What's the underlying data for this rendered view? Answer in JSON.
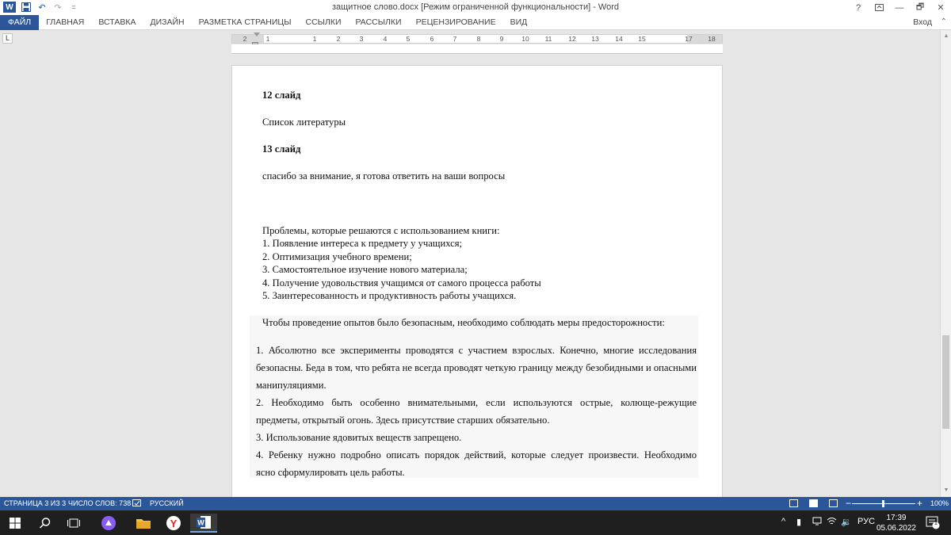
{
  "window": {
    "title": "защитное слово.docx [Режим ограниченной функциональности] - Word",
    "help": "?",
    "minimize": "—",
    "restore": "🗗",
    "close": "✕",
    "app_logo": "W"
  },
  "qat": {
    "save_icon": "save-icon",
    "undo_icon": "undo-icon",
    "redo_icon": "redo-icon",
    "customize": "="
  },
  "ribbon": {
    "tabs": [
      "ФАЙЛ",
      "ГЛАВНАЯ",
      "ВСТАВКА",
      "ДИЗАЙН",
      "РАЗМЕТКА СТРАНИЦЫ",
      "ССЫЛКИ",
      "РАССЫЛКИ",
      "РЕЦЕНЗИРОВАНИЕ",
      "ВИД"
    ],
    "signin": "Вход",
    "collapse": "⌃"
  },
  "ruler": {
    "tab_selector": "L",
    "numbers": [
      "2",
      "1",
      "1",
      "2",
      "3",
      "4",
      "5",
      "6",
      "7",
      "8",
      "9",
      "10",
      "11",
      "12",
      "13",
      "14",
      "15",
      "17",
      "18"
    ]
  },
  "document": {
    "h12": "12 слайд",
    "p1": "Список литературы",
    "h13": "13 слайд",
    "p2": "спасибо за внимание, я готова ответить на ваши вопросы",
    "problems_title": "Проблемы, которые решаются с использованием книги:",
    "problems": [
      "1.  Появление интереса к предмету у учащихся;",
      "2.  Оптимизация учебного времени;",
      "3.  Самостоятельное изучение нового материала;",
      "4.  Получение удовольствия учащимся от самого процесса работы",
      "5.  Заинтересованность и продуктивность работы учащихся."
    ],
    "safety_intro": "Чтобы проведение опытов было безопасным, необходимо соблюдать меры предосторожности:",
    "safety": [
      {
        "lines": [
          "1.    Абсолютно все эксперименты проводятся с участием взрослых. Конечно, многие исследования",
          "безопасны. Беда в том, что ребята не всегда проводят четкую границу между безобидными и опасными",
          "манипуляциями."
        ]
      },
      {
        "lines": [
          "2.    Необходимо быть особенно внимательными, если используются острые, колюще-режущие",
          "предметы, открытый огонь. Здесь присутствие старших обязательно."
        ]
      },
      {
        "lines": [
          "3.    Использование ядовитых веществ запрещено."
        ]
      },
      {
        "lines": [
          "4.    Ребенку нужно подробно описать порядок действий, которые следует произвести. Необходимо",
          "ясно сформулировать цель работы."
        ]
      }
    ]
  },
  "status": {
    "page": "СТРАНИЦА 3 ИЗ 3",
    "words": "ЧИСЛО СЛОВ: 738",
    "lang": "РУССКИЙ",
    "zoom": "100%",
    "zoom_minus": "−",
    "zoom_plus": "+"
  },
  "taskbar": {
    "lang": "РУС",
    "time": "17:39",
    "date": "05.06.2022",
    "notif_count": "1"
  },
  "colors": {
    "accent": "#2b579a"
  }
}
